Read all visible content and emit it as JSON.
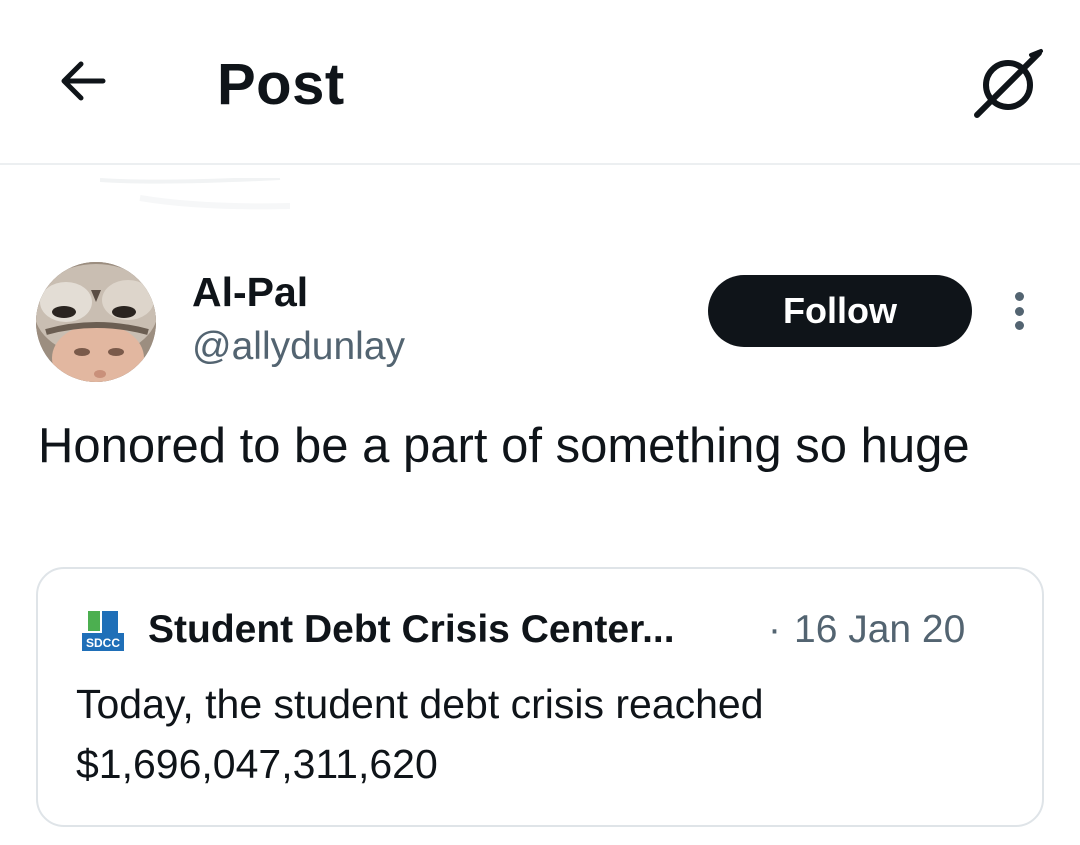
{
  "header": {
    "title": "Post",
    "back_icon": "arrow-left-icon",
    "grok_icon": "grok-icon"
  },
  "post": {
    "author": {
      "display_name": "Al-Pal",
      "handle": "@allydunlay",
      "avatar": "user-avatar"
    },
    "follow_label": "Follow",
    "more_icon": "more-vertical-icon",
    "text": "Honored to be a part of something so huge"
  },
  "quote": {
    "logo_text": "SDCC",
    "author_name": "Student Debt Crisis Center...",
    "separator": "·",
    "date": "16 Jan 20",
    "text": "Today, the student debt crisis reached $1,696,047,311,620"
  },
  "colors": {
    "text_primary": "#0f1419",
    "text_secondary": "#536471",
    "border": "#dfe4e8",
    "button_bg": "#0f1419",
    "logo_blue": "#1f6fb8",
    "logo_green": "#4caf50"
  }
}
